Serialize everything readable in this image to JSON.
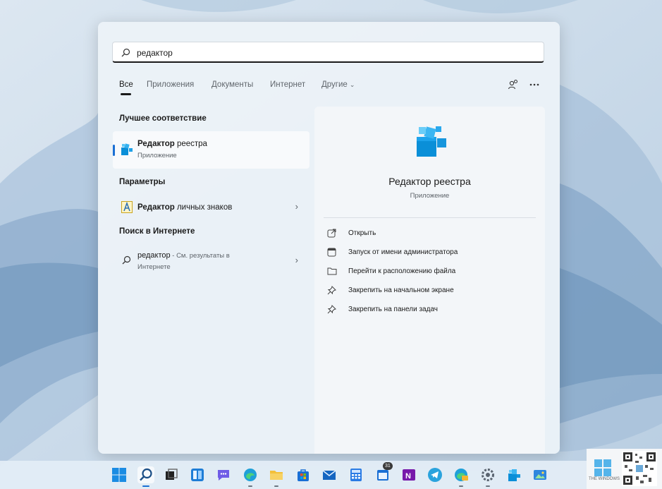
{
  "search": {
    "value": "редактор"
  },
  "tabs": [
    {
      "label": "Все",
      "active": true
    },
    {
      "label": "Приложения"
    },
    {
      "label": "Документы"
    },
    {
      "label": "Интернет"
    },
    {
      "label": "Другие"
    }
  ],
  "header_icons": [
    "account-switch-icon",
    "more-icon"
  ],
  "sections": {
    "best_match": "Лучшее соответствие",
    "settings": "Параметры",
    "web_search": "Поиск в Интернете"
  },
  "best_match": {
    "title_bold": "Редактор",
    "title_rest": " реестра",
    "subtitle": "Приложение"
  },
  "settings_item": {
    "title_bold": "Редактор",
    "title_rest": " личных знаков"
  },
  "web_item": {
    "query": "редактор",
    "hint": " - См. результаты в",
    "hint2": "Интернете"
  },
  "detail": {
    "title": "Редактор реестра",
    "subtitle": "Приложение",
    "actions": [
      {
        "label": "Открыть",
        "icon": "open-icon"
      },
      {
        "label": "Запуск от имени администратора",
        "icon": "admin-shield-icon"
      },
      {
        "label": "Перейти к расположению файла",
        "icon": "folder-icon"
      },
      {
        "label": "Закрепить на начальном экране",
        "icon": "pin-icon"
      },
      {
        "label": "Закрепить на панели задач",
        "icon": "pin-icon"
      }
    ]
  },
  "taskbar": {
    "icons": [
      "windows-start-icon",
      "search-icon",
      "task-view-icon",
      "widgets-icon",
      "chat-icon",
      "edge-icon",
      "file-explorer-icon",
      "store-icon",
      "mail-icon",
      "calculator-icon",
      "calendar-icon",
      "onenote-icon",
      "telegram-icon",
      "edge-canary-icon",
      "settings-icon",
      "registry-editor-icon",
      "photos-icon"
    ],
    "calendar_badge": "31"
  },
  "watermark": {
    "text": "THE WINDOWS"
  },
  "colors": {
    "accent": "#1a6fd4",
    "registry_blue": "#0a8fd8"
  }
}
